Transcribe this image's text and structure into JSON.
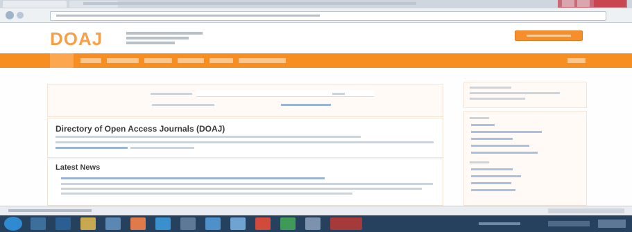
{
  "site": {
    "logo": "DOAJ"
  },
  "main": {
    "title": "Directory of Open Access Journals (DOAJ)",
    "latest_heading": "Latest News"
  },
  "colors": {
    "brand_orange": "#f68e22",
    "logo_orange": "#f6a04a",
    "taskbar": "#26415e"
  },
  "icons": [
    "browser-back-icon",
    "browser-forward-icon",
    "windows-start-icon"
  ]
}
